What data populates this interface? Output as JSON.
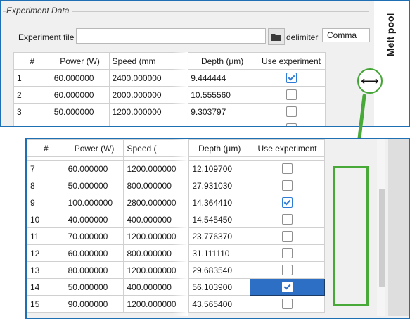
{
  "group": {
    "title": "Experiment Data"
  },
  "file": {
    "label": "Experiment file",
    "value": ""
  },
  "delimiter": {
    "label": "delimiter",
    "value": "Comma"
  },
  "side_panel": {
    "title": "Melt pool"
  },
  "table": {
    "headers": [
      "#",
      "Power (W)",
      "Speed (mm",
      "Depth (µm)",
      "Use experiment"
    ],
    "headers_bottom": [
      "#",
      "Power (W)",
      "Speed (",
      "Depth (µm)",
      "Use experiment"
    ]
  },
  "top_rows": [
    {
      "n": "1",
      "power": "60.000000",
      "speed": "2400.000000",
      "depth": "9.444444",
      "use": true
    },
    {
      "n": "2",
      "power": "60.000000",
      "speed": "2000.000000",
      "depth": "10.555560",
      "use": false
    },
    {
      "n": "3",
      "power": "50.000000",
      "speed": "1200.000000",
      "depth": "9.303797",
      "use": false
    }
  ],
  "bottom_rows": [
    {
      "n": "7",
      "power": "60.000000",
      "speed": "1200.000000",
      "depth": "12.109700",
      "use": false
    },
    {
      "n": "8",
      "power": "50.000000",
      "speed": "800.000000",
      "depth": "27.931030",
      "use": false
    },
    {
      "n": "9",
      "power": "100.000000",
      "speed": "2800.000000",
      "depth": "14.364410",
      "use": true
    },
    {
      "n": "10",
      "power": "40.000000",
      "speed": "400.000000",
      "depth": "14.545450",
      "use": false
    },
    {
      "n": "11",
      "power": "70.000000",
      "speed": "1200.000000",
      "depth": "23.776370",
      "use": false
    },
    {
      "n": "12",
      "power": "60.000000",
      "speed": "800.000000",
      "depth": "31.111110",
      "use": false
    },
    {
      "n": "13",
      "power": "80.000000",
      "speed": "1200.000000",
      "depth": "29.683540",
      "use": false
    },
    {
      "n": "14",
      "power": "50.000000",
      "speed": "400.000000",
      "depth": "56.103900",
      "use": true,
      "selected": true
    },
    {
      "n": "15",
      "power": "90.000000",
      "speed": "1200.000000",
      "depth": "43.565400",
      "use": false
    }
  ],
  "icons": {
    "folder": "folder-icon",
    "resize": "resize-horizontal-icon",
    "arrow": "arrow-down-icon"
  },
  "colors": {
    "panel_border": "#1f6fb5",
    "highlight_green": "#48a838",
    "selection": "#2d6fc4"
  }
}
